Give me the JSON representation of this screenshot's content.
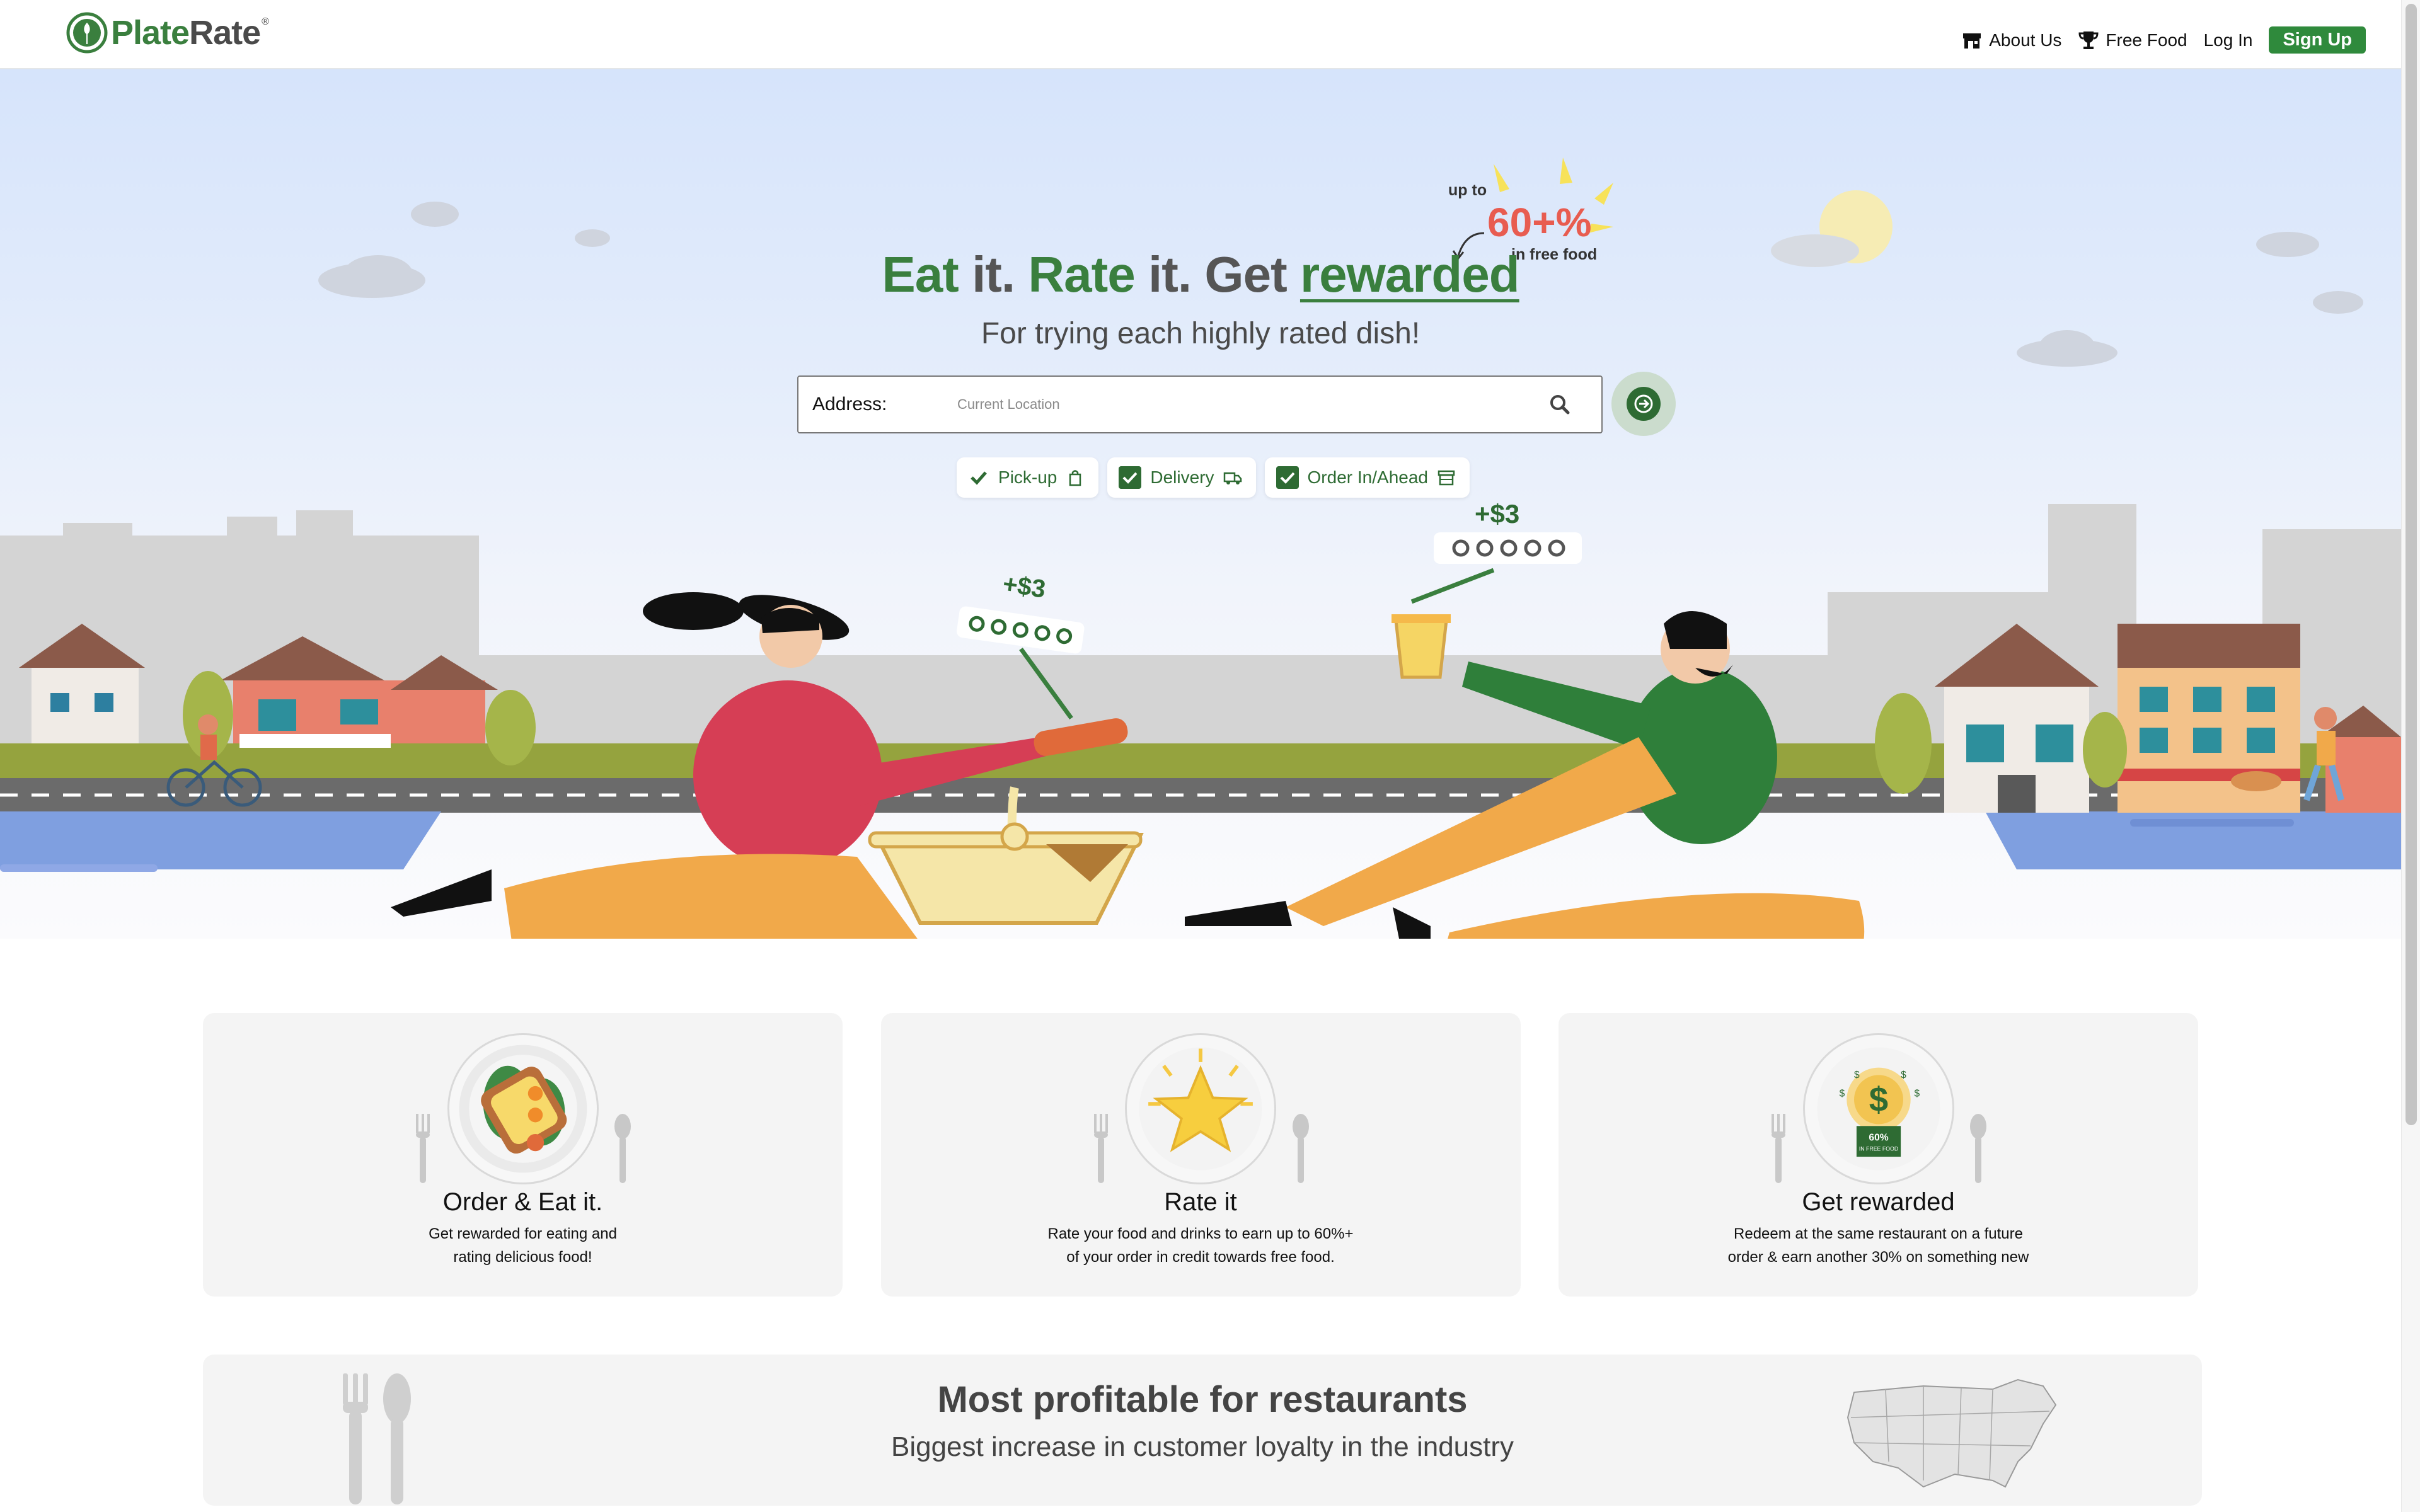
{
  "brand": {
    "name_part1": "Plate",
    "name_part2": "Rate",
    "reg": "®"
  },
  "nav": {
    "about": "About Us",
    "free_food": "Free Food",
    "login": "Log In",
    "signup": "Sign Up"
  },
  "hero": {
    "headline": {
      "w1": "Eat",
      "w2": "it.",
      "w3": "Rate",
      "w4": "it. Get",
      "w5": "rewarded"
    },
    "subhead": "For trying each highly rated dish!",
    "promo": {
      "upto": "up to",
      "big": "60+%",
      "sub": "in free food"
    },
    "search": {
      "label": "Address:",
      "placeholder": "Current Location"
    },
    "options": [
      {
        "label": "Pick-up",
        "checked": true,
        "style": "plain"
      },
      {
        "label": "Delivery",
        "checked": true,
        "style": "box"
      },
      {
        "label": "Order In/Ahead",
        "checked": true,
        "style": "box"
      }
    ],
    "tags": {
      "left": "+$3",
      "right": "+$3"
    }
  },
  "steps": [
    {
      "title": "Order & Eat it.",
      "desc": [
        "Get rewarded for eating and",
        "rating delicious food!"
      ]
    },
    {
      "title": "Rate it",
      "desc": [
        "Rate your food and drinks to earn up to 60%+",
        "of your order in credit towards free food."
      ]
    },
    {
      "title": "Get rewarded",
      "desc": [
        "Redeem at the same restaurant on a future",
        "order & earn another 30% on something new"
      ],
      "badge_top": "60%",
      "badge_bottom": "IN FREE FOOD"
    }
  ],
  "banner": {
    "title": "Most profitable for restaurants",
    "subtitle": "Biggest increase in customer loyalty in the industry"
  },
  "colors": {
    "brand_green": "#3a7f3e",
    "dark_green": "#2e6b33",
    "signup_green": "#2f8a3c",
    "promo_red": "#e85c50"
  }
}
